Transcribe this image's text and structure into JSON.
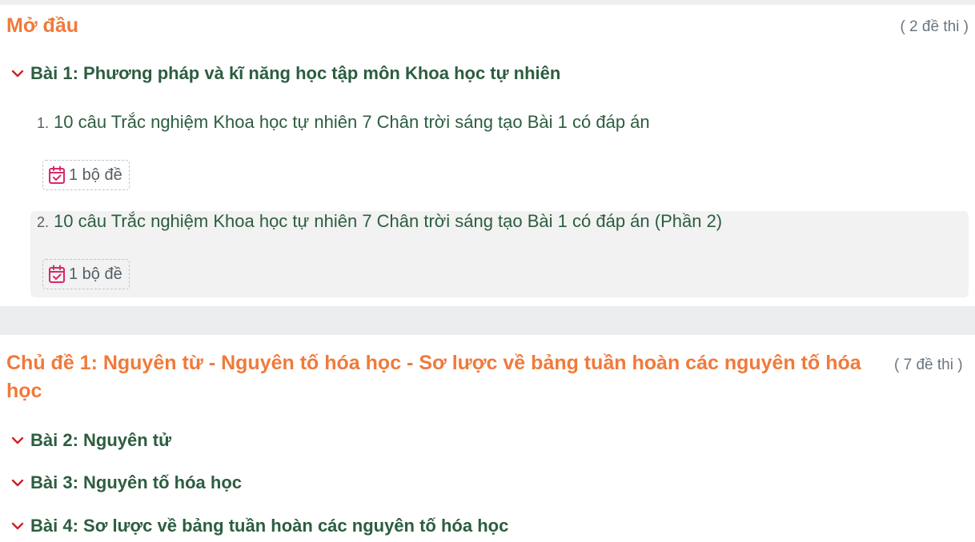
{
  "colors": {
    "section_title": "#f07a3a",
    "lesson_title": "#2c5d3f",
    "chevron": "#d0202a",
    "badge_icon": "#d8286a",
    "muted": "#6b7580"
  },
  "sections": [
    {
      "title": "Mở đầu",
      "count": "( 2 đề thi )",
      "lessons": [
        {
          "title": "Bài 1: Phương pháp và kĩ năng học tập môn Khoa học tự nhiên",
          "icon": "chevron-down-icon",
          "items": [
            {
              "num": "1.",
              "title": "10 câu Trắc nghiệm Khoa học tự nhiên 7 Chân trời sáng tạo Bài 1 có đáp án",
              "badge": "1 bộ đề",
              "badge_icon": "calendar-check-icon"
            },
            {
              "num": "2.",
              "title": "10 câu Trắc nghiệm Khoa học tự nhiên 7 Chân trời sáng tạo Bài 1 có đáp án (Phần 2)",
              "badge": "1 bộ đề",
              "badge_icon": "calendar-check-icon"
            }
          ]
        }
      ]
    },
    {
      "title": "Chủ đề 1: Nguyên từ - Nguyên tố hóa học - Sơ lược về bảng tuần hoàn các nguyên tố hóa học",
      "count": "( 7 đề thi )",
      "lessons": [
        {
          "title": "Bài 2: Nguyên tử",
          "icon": "chevron-down-icon"
        },
        {
          "title": "Bài 3: Nguyên tố hóa học",
          "icon": "chevron-down-icon"
        },
        {
          "title": "Bài 4: Sơ lược về bảng tuần hoàn các nguyên tố hóa học",
          "icon": "chevron-down-icon"
        }
      ]
    }
  ]
}
